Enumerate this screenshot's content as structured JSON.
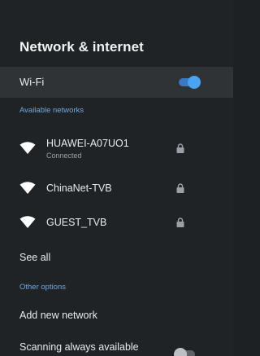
{
  "page": {
    "title": "Network & internet"
  },
  "wifi": {
    "label": "Wi-Fi",
    "enabled": true,
    "toggle_icon": "toggle-on-icon",
    "accent": "#4aa2f2"
  },
  "available": {
    "header": "Available networks",
    "networks": [
      {
        "name": "HUAWEI-A07UO1",
        "status": "Connected",
        "icon": "wifi-full-icon",
        "locked": true
      },
      {
        "name": "ChinaNet-TVB",
        "status": "",
        "icon": "wifi-full-icon",
        "locked": true
      },
      {
        "name": "GUEST_TVB",
        "status": "",
        "icon": "wifi-full-icon",
        "locked": true
      }
    ],
    "see_all": "See all"
  },
  "other": {
    "header": "Other options",
    "add_network": "Add new network",
    "scanning": "Scanning always available",
    "scanning_enabled": false
  },
  "colors": {
    "background": "#202326",
    "selected_row": "#2f3336",
    "section_header": "#6fa8dc",
    "secondary_text": "#9aa0a6"
  }
}
